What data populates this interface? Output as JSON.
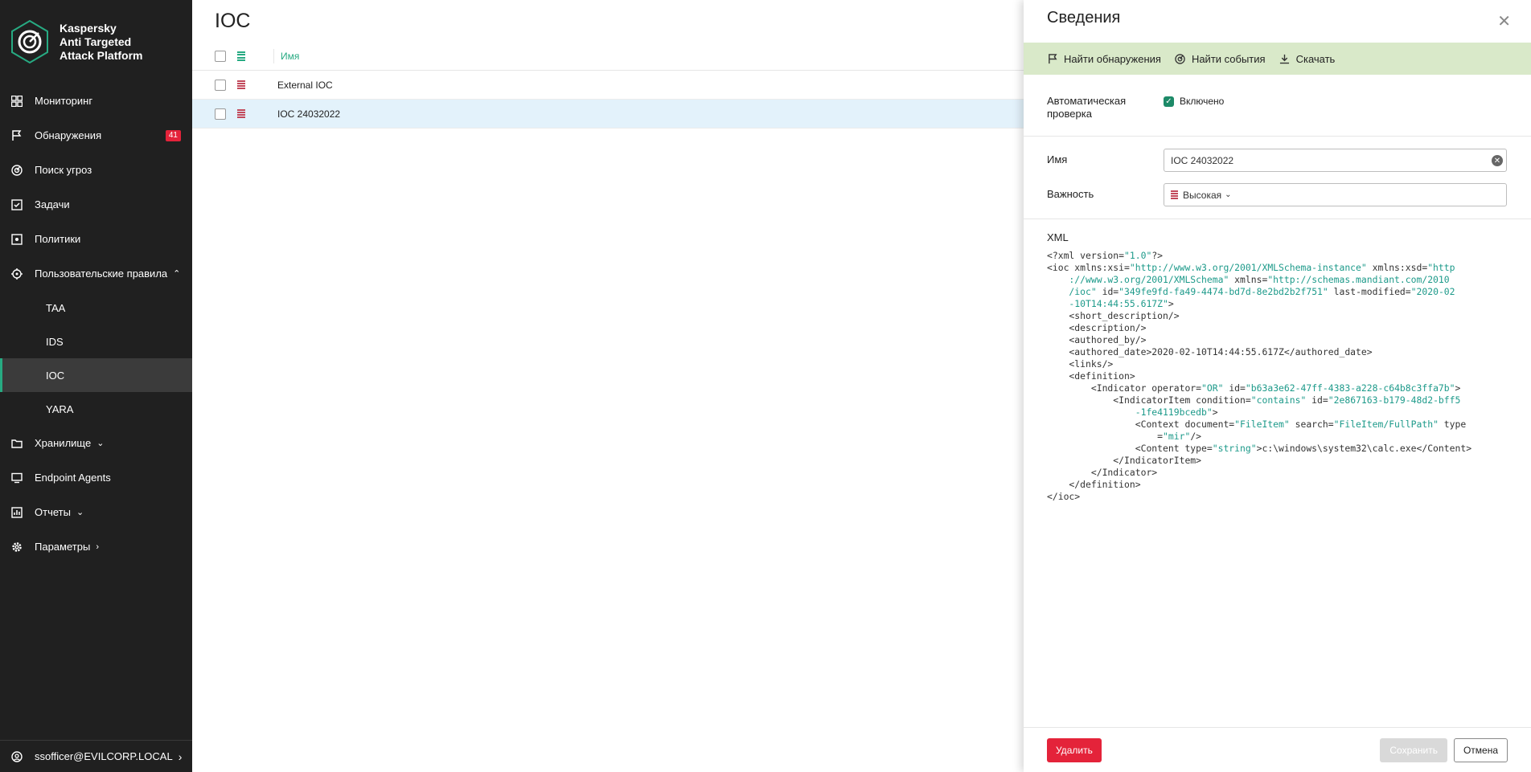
{
  "sidebar": {
    "brand": [
      "Kaspersky",
      "Anti Targeted",
      "Attack Platform"
    ],
    "items": [
      {
        "label": "Мониторинг",
        "icon": "dashboard-icon"
      },
      {
        "label": "Обнаружения",
        "icon": "flag-icon",
        "badge": "41"
      },
      {
        "label": "Поиск угроз",
        "icon": "threat-hunting-icon"
      },
      {
        "label": "Задачи",
        "icon": "tasks-icon"
      },
      {
        "label": "Политики",
        "icon": "policies-icon"
      },
      {
        "label": "Пользовательские правила",
        "icon": "rules-icon"
      }
    ],
    "subitems": [
      "TAA",
      "IDS",
      "IOC",
      "YARA"
    ],
    "items2": [
      {
        "label": "Хранилище",
        "icon": "storage-icon"
      },
      {
        "label": "Endpoint Agents",
        "icon": "monitor-icon"
      },
      {
        "label": "Отчеты",
        "icon": "reports-icon"
      },
      {
        "label": "Параметры",
        "icon": "gear-icon"
      }
    ],
    "user": "ssofficer@EVILCORP.LOCAL"
  },
  "main": {
    "title": "IOC",
    "table": {
      "column_name": "Имя",
      "rows": [
        {
          "name": "External IOC",
          "selected": false
        },
        {
          "name": "IOC 24032022",
          "selected": true
        }
      ]
    }
  },
  "panel": {
    "title": "Сведения",
    "toolbar": [
      "Найти обнаружения",
      "Найти события",
      "Скачать"
    ],
    "auto_check_label": [
      "Автоматическая",
      "проверка"
    ],
    "auto_check_value": "Включено",
    "name_label": "Имя",
    "name_value": "IOC 24032022",
    "severity_label": "Важность",
    "severity_value": "Высокая",
    "xml_label": "XML",
    "xml_lines": [
      [
        [
          "t",
          "<?xml version="
        ],
        [
          "v",
          "\"1.0\""
        ],
        [
          "t",
          "?>"
        ]
      ],
      [
        [
          "t",
          "<ioc xmlns:xsi="
        ],
        [
          "v",
          "\"http://www.w3.org/2001/XMLSchema-instance\""
        ],
        [
          "t",
          " xmlns:xsd="
        ],
        [
          "v",
          "\"http"
        ]
      ],
      [
        [
          "v",
          "    ://www.w3.org/2001/XMLSchema\""
        ],
        [
          "t",
          " xmlns="
        ],
        [
          "v",
          "\"http://schemas.mandiant.com/2010"
        ]
      ],
      [
        [
          "v",
          "    /ioc\""
        ],
        [
          "t",
          " id="
        ],
        [
          "v",
          "\"349fe9fd-fa49-4474-bd7d-8e2bd2b2f751\""
        ],
        [
          "t",
          " last-modified="
        ],
        [
          "v",
          "\"2020-02"
        ]
      ],
      [
        [
          "v",
          "    -10T14:44:55.617Z\""
        ],
        [
          "t",
          ">"
        ]
      ],
      [
        [
          "t",
          "    <short_description/>"
        ]
      ],
      [
        [
          "t",
          "    <description/>"
        ]
      ],
      [
        [
          "t",
          "    <authored_by/>"
        ]
      ],
      [
        [
          "t",
          "    <authored_date>2020-02-10T14:44:55.617Z</authored_date>"
        ]
      ],
      [
        [
          "t",
          "    <links/>"
        ]
      ],
      [
        [
          "t",
          "    <definition>"
        ]
      ],
      [
        [
          "t",
          "        <Indicator operator="
        ],
        [
          "v",
          "\"OR\""
        ],
        [
          "t",
          " id="
        ],
        [
          "v",
          "\"b63a3e62-47ff-4383-a228-c64b8c3ffa7b\""
        ],
        [
          "t",
          ">"
        ]
      ],
      [
        [
          "t",
          "            <IndicatorItem condition="
        ],
        [
          "v",
          "\"contains\""
        ],
        [
          "t",
          " id="
        ],
        [
          "v",
          "\"2e867163-b179-48d2-bff5"
        ]
      ],
      [
        [
          "v",
          "                -1fe4119bcedb\""
        ],
        [
          "t",
          ">"
        ]
      ],
      [
        [
          "t",
          "                <Context document="
        ],
        [
          "v",
          "\"FileItem\""
        ],
        [
          "t",
          " search="
        ],
        [
          "v",
          "\"FileItem/FullPath\""
        ],
        [
          "t",
          " type"
        ]
      ],
      [
        [
          "t",
          "                    ="
        ],
        [
          "v",
          "\"mir\""
        ],
        [
          "t",
          "/>"
        ]
      ],
      [
        [
          "t",
          "                <Content type="
        ],
        [
          "v",
          "\"string\""
        ],
        [
          "t",
          ">c:\\windows\\system32\\calc.exe</Content>"
        ]
      ],
      [
        [
          "t",
          "            </IndicatorItem>"
        ]
      ],
      [
        [
          "t",
          "        </Indicator>"
        ]
      ],
      [
        [
          "t",
          "    </definition>"
        ]
      ],
      [
        [
          "t",
          "</ioc>"
        ]
      ]
    ],
    "delete_btn": "Удалить",
    "save_btn": "Сохранить",
    "cancel_btn": "Отмена"
  }
}
